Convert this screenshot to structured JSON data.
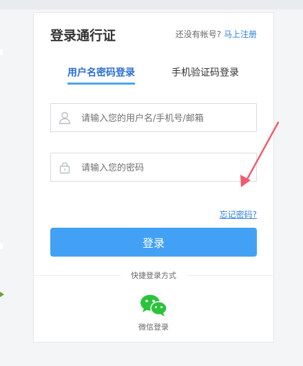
{
  "header": {
    "title": "登录通行证",
    "signup_prompt": "还没有帐号?",
    "signup_link": "马上注册"
  },
  "tabs": [
    {
      "label": "用户名密码登录",
      "active": true
    },
    {
      "label": "手机验证码登录",
      "active": false
    }
  ],
  "form": {
    "username_placeholder": "请输入您的用户名/手机号/邮箱",
    "password_placeholder": "请输入您的密码",
    "forgot_label": "忘记密码?",
    "login_label": "登录"
  },
  "quick_login": {
    "label": "快捷登录方式",
    "wechat_label": "微信登录"
  },
  "colors": {
    "primary": "#42a1f4",
    "link": "#2f7fe0",
    "wechat": "#2ac43b",
    "arrow": "#ef5b6d"
  },
  "icons": {
    "user": "user-icon",
    "lock": "lock-icon",
    "wechat": "wechat-icon",
    "arrow": "arrow-annotation"
  }
}
